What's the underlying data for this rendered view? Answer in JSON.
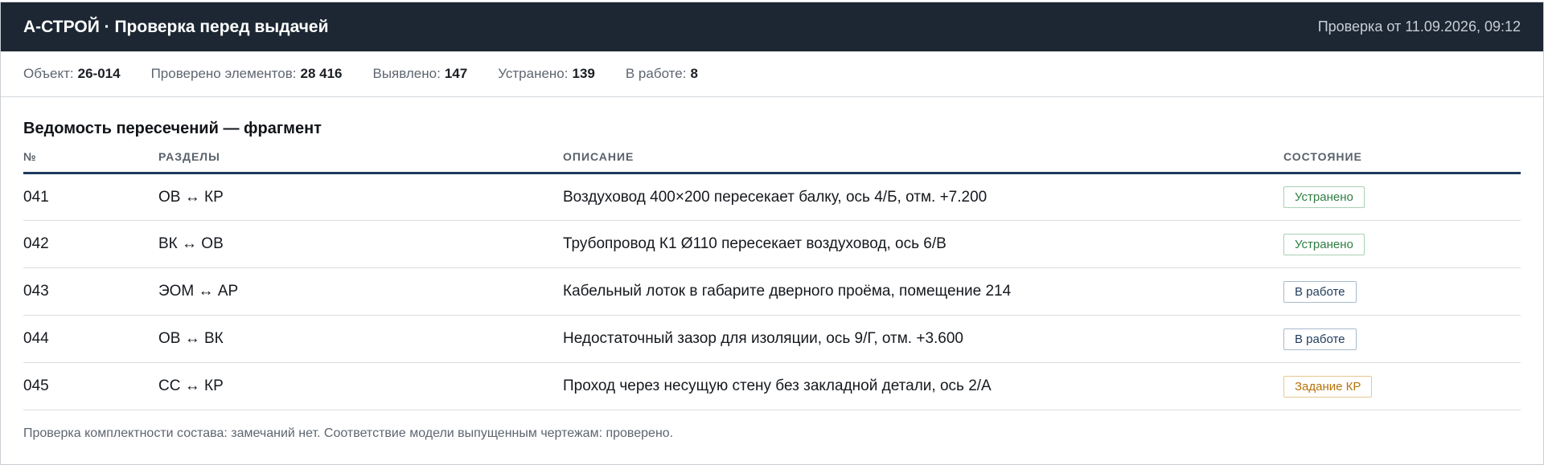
{
  "header": {
    "title": "А-СТРОЙ · Проверка перед выдачей",
    "timestamp": "Проверка от 11.09.2026, 09:12"
  },
  "summary": [
    {
      "label": "Объект:",
      "value": "26-014"
    },
    {
      "label": "Проверено элементов:",
      "value": "28 416"
    },
    {
      "label": "Выявлено:",
      "value": "147"
    },
    {
      "label": "Устранено:",
      "value": "139"
    },
    {
      "label": "В работе:",
      "value": "8"
    }
  ],
  "section_title": "Ведомость пересечений — фрагмент",
  "table": {
    "columns": [
      "№",
      "РАЗДЕЛЫ",
      "ОПИСАНИЕ",
      "СОСТОЯНИЕ"
    ],
    "rows": [
      {
        "no": "041",
        "sections": "ОВ ↔ КР",
        "description": "Воздуховод 400×200 пересекает балку, ось 4/Б, отм. +7.200",
        "status": "Устранено",
        "status_kind": "done"
      },
      {
        "no": "042",
        "sections": "ВК ↔ ОВ",
        "description": "Трубопровод К1 Ø110 пересекает воздуховод, ось 6/В",
        "status": "Устранено",
        "status_kind": "done"
      },
      {
        "no": "043",
        "sections": "ЭОМ ↔ АР",
        "description": "Кабельный лоток в габарите дверного проёма, помещение 214",
        "status": "В работе",
        "status_kind": "work"
      },
      {
        "no": "044",
        "sections": "ОВ ↔ ВК",
        "description": "Недостаточный зазор для изоляции, ось 9/Г, отм. +3.600",
        "status": "В работе",
        "status_kind": "work"
      },
      {
        "no": "045",
        "sections": "СС ↔ КР",
        "description": "Проход через несущую стену без закладной детали, ось 2/А",
        "status": "Задание КР",
        "status_kind": "task"
      }
    ]
  },
  "footnote": "Проверка комплектности состава: замечаний нет. Соответствие модели выпущенным чертежам: проверено.",
  "colors": {
    "header_bg": "#1c2733",
    "accent_rule": "#1e3a5f",
    "status_done": "#2e7d43",
    "status_work": "#1f3b5c",
    "status_task": "#b7730a"
  }
}
